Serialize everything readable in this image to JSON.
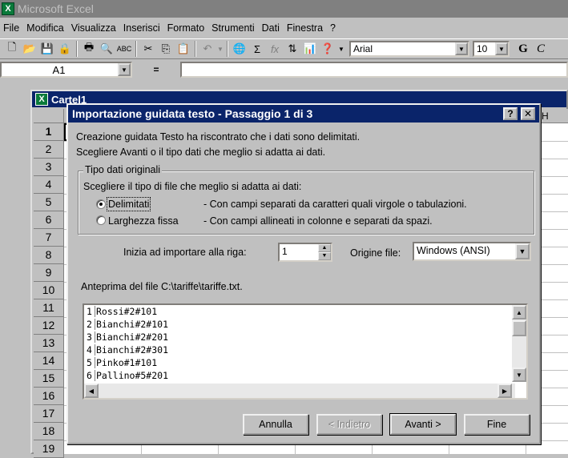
{
  "app": {
    "title": "Microsoft Excel"
  },
  "menu": [
    "File",
    "Modifica",
    "Visualizza",
    "Inserisci",
    "Formato",
    "Strumenti",
    "Dati",
    "Finestra",
    "?"
  ],
  "toolbar": {
    "font_name": "Arial",
    "font_size": "10",
    "bold_label": "G",
    "italic_label": "C"
  },
  "formula_bar": {
    "name_box": "A1",
    "equals": "=",
    "value": ""
  },
  "workbook": {
    "title": "Cartel1",
    "visible_column_letter": "H",
    "rows": [
      "1",
      "2",
      "3",
      "4",
      "5",
      "6",
      "7",
      "8",
      "9",
      "10",
      "11",
      "12",
      "13",
      "14",
      "15",
      "16",
      "17",
      "18",
      "19"
    ]
  },
  "dialog": {
    "title": "Importazione guidata testo - Passaggio 1 di 3",
    "help_button": "?",
    "close_button": "✕",
    "intro_line1": "Creazione guidata Testo ha riscontrato che i dati sono delimitati.",
    "intro_line2": "Scegliere Avanti o il tipo dati che meglio si adatta ai dati.",
    "group_label": "Tipo dati originali",
    "group_prompt": "Scegliere il tipo di file che meglio si adatta ai dati:",
    "option_delimited": {
      "label": "Delimitati",
      "description": "- Con campi separati da caratteri quali virgole o tabulazioni.",
      "selected": true
    },
    "option_fixed": {
      "label": "Larghezza fissa",
      "description": "- Con campi allineati in colonne e separati da spazi.",
      "selected": false
    },
    "start_row_label": "Inizia ad importare alla riga:",
    "start_row_value": "1",
    "origin_label": "Origine file:",
    "origin_value": "Windows (ANSI)",
    "preview_label": "Anteprima del file C:\\tariffe\\tariffe.txt.",
    "preview_rows": [
      {
        "n": "1",
        "text": "Rossi#2#101"
      },
      {
        "n": "2",
        "text": "Bianchi#2#101"
      },
      {
        "n": "3",
        "text": "Bianchi#2#201"
      },
      {
        "n": "4",
        "text": "Bianchi#2#301"
      },
      {
        "n": "5",
        "text": "Pinko#1#101"
      },
      {
        "n": "6",
        "text": "Pallino#5#201"
      }
    ],
    "buttons": {
      "cancel": "Annulla",
      "back": "< Indietro",
      "next": "Avanti >",
      "finish": "Fine"
    }
  }
}
